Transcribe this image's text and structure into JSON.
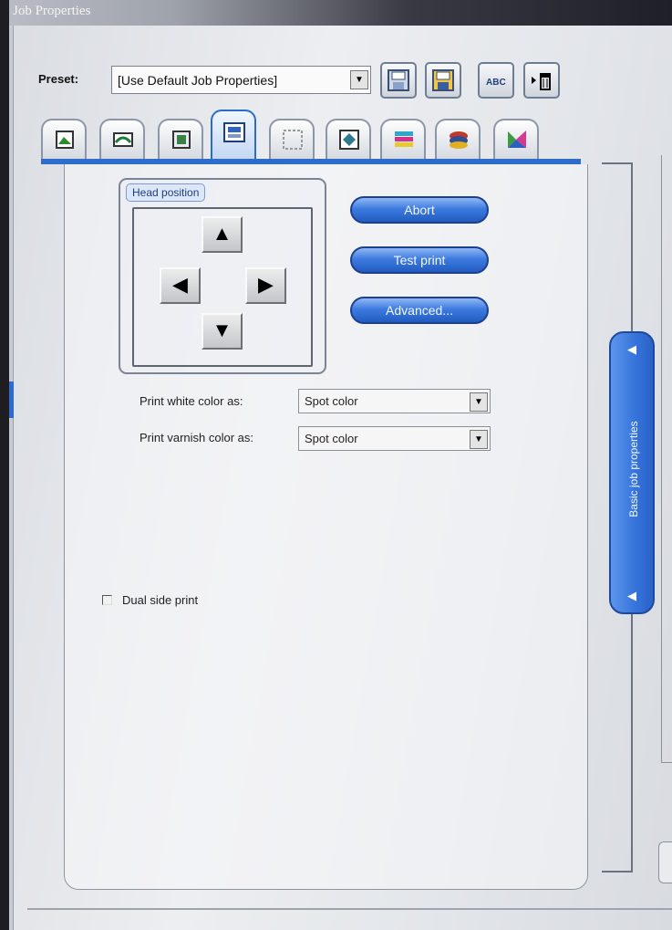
{
  "window": {
    "title": "Job Properties"
  },
  "preset": {
    "label": "Preset:",
    "value": "[Use Default Job Properties]",
    "dropdown_arrow": "▼"
  },
  "toolbar": [
    {
      "name": "save-icon"
    },
    {
      "name": "save-as-icon"
    },
    {
      "name": "abc-rename-icon",
      "text": "ABC"
    },
    {
      "name": "delete-icon"
    }
  ],
  "tabs": [
    {
      "name": "tab-1-icon"
    },
    {
      "name": "tab-2-icon"
    },
    {
      "name": "tab-3-icon"
    },
    {
      "name": "tab-4-icon",
      "active": true
    },
    {
      "name": "tab-5-icon"
    },
    {
      "name": "tab-6-icon"
    },
    {
      "name": "tab-7-icon"
    },
    {
      "name": "tab-8-icon"
    },
    {
      "name": "tab-9-icon"
    }
  ],
  "head_position": {
    "label": "Head position",
    "arrows": {
      "up": "▲",
      "down": "▼",
      "left": "◀",
      "right": "▶"
    }
  },
  "buttons": {
    "abort": "Abort",
    "test_print": "Test print",
    "advanced": "Advanced..."
  },
  "white_color": {
    "label": "Print white color as:",
    "value": "Spot color",
    "arrow": "▼"
  },
  "varnish_color": {
    "label": "Print varnish color as:",
    "value": "Spot color",
    "arrow": "▼"
  },
  "dual_side": {
    "label": "Dual side print",
    "checked": false
  },
  "side_panel": {
    "label": "Basic job properties",
    "arrow_top": "◀",
    "arrow_bottom": "◀"
  }
}
